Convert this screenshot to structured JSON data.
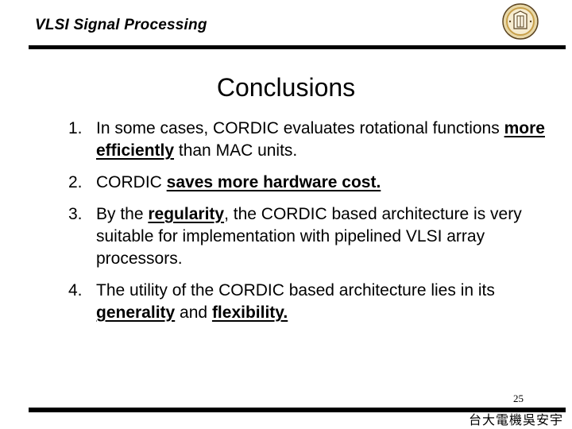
{
  "header": {
    "title": "VLSI Signal Processing",
    "logo_icon": "university-seal-icon"
  },
  "slide": {
    "title": "Conclusions",
    "items": [
      {
        "number": "1.",
        "before": "In some cases, CORDIC evaluates rotational functions  ",
        "emphasis": "more efficiently",
        "after": " than MAC units."
      },
      {
        "number": "2.",
        "before": "CORDIC ",
        "emphasis": "saves more hardware cost.",
        "after": ""
      },
      {
        "number": "3.",
        "before": "By the ",
        "emphasis": "regularity",
        "after": ", the CORDIC based architecture is very suitable for implementation with pipelined VLSI array processors."
      },
      {
        "number": "4.",
        "before": "The utility of the CORDIC based architecture lies in its ",
        "emphasis": "generality",
        "middle": " and ",
        "emphasis2": "flexibility."
      }
    ]
  },
  "footer": {
    "page_number": "25",
    "credit": "台大電機吳安宇"
  },
  "colors": {
    "text": "#000000",
    "background": "#ffffff",
    "logo_gold": "#c8a04a",
    "logo_dark": "#5a4320"
  }
}
